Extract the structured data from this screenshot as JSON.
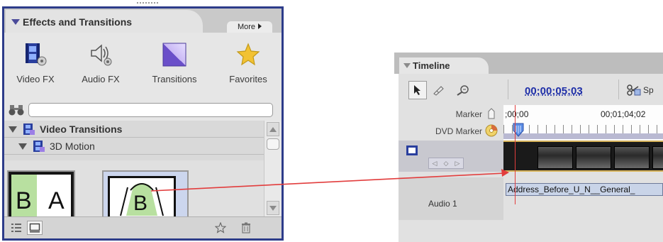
{
  "effects_panel": {
    "title": "Effects and Transitions",
    "more_label": "More",
    "categories": [
      {
        "label": "Video FX",
        "icon": "film-gear-icon"
      },
      {
        "label": "Audio FX",
        "icon": "speaker-gear-icon"
      },
      {
        "label": "Transitions",
        "icon": "transition-square-icon"
      },
      {
        "label": "Favorites",
        "icon": "star-icon"
      }
    ],
    "search": {
      "value": "",
      "placeholder": ""
    },
    "tree": {
      "group_label": "Video Transitions",
      "subgroup_label": "3D Motion"
    },
    "thumbnails": [
      {
        "left": "B",
        "right": "A",
        "name": "cube-spin"
      },
      {
        "center": "B",
        "name": "curtain"
      }
    ]
  },
  "timeline_panel": {
    "title": "Timeline",
    "timecode": "00;00;05;03",
    "split_label": "Sp",
    "marker_label": "Marker",
    "dvd_marker_label": "DVD Marker",
    "ruler_start": ";00;00",
    "ruler_mark": "00;01;04;02",
    "clip_name": "Address_Before_U_N__General_",
    "audio_track_label": "Audio 1"
  },
  "colors": {
    "panel_border": "#2d3c8a",
    "timecode": "#1f2fa8",
    "annotation_arrow": "#e23d3d",
    "star": "#f2c233"
  }
}
